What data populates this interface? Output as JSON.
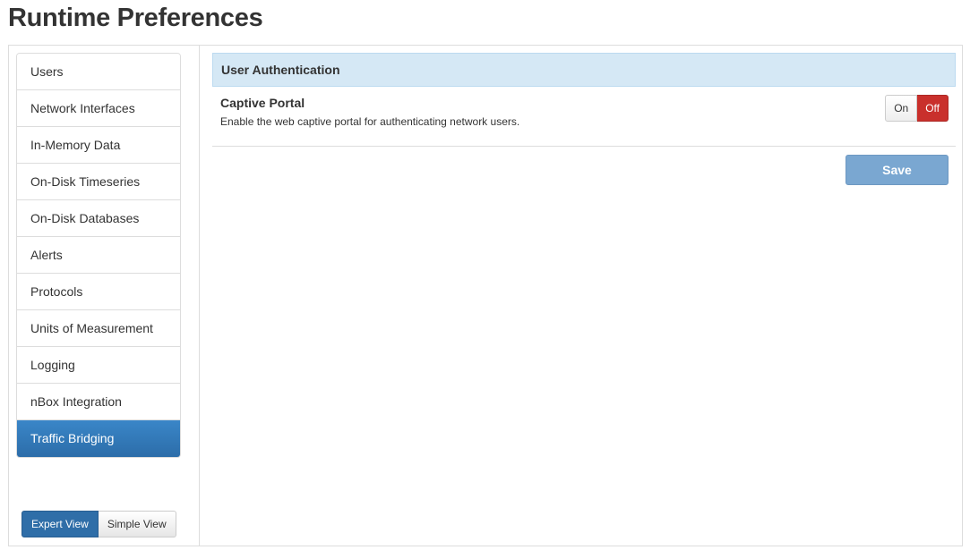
{
  "page": {
    "title": "Runtime Preferences"
  },
  "sidebar": {
    "items": [
      {
        "label": "Users",
        "active": false
      },
      {
        "label": "Network Interfaces",
        "active": false
      },
      {
        "label": "In-Memory Data",
        "active": false
      },
      {
        "label": "On-Disk Timeseries",
        "active": false
      },
      {
        "label": "On-Disk Databases",
        "active": false
      },
      {
        "label": "Alerts",
        "active": false
      },
      {
        "label": "Protocols",
        "active": false
      },
      {
        "label": "Units of Measurement",
        "active": false
      },
      {
        "label": "Logging",
        "active": false
      },
      {
        "label": "nBox Integration",
        "active": false
      },
      {
        "label": "Traffic Bridging",
        "active": true
      }
    ],
    "view_toggle": {
      "expert_label": "Expert View",
      "simple_label": "Simple View",
      "selected": "Expert View"
    }
  },
  "main": {
    "section_heading": "User Authentication",
    "settings": [
      {
        "title": "Captive Portal",
        "description": "Enable the web captive portal for authenticating network users.",
        "on_label": "On",
        "off_label": "Off",
        "value": "Off"
      }
    ],
    "save_label": "Save"
  },
  "colors": {
    "active_nav": "#2c6da9",
    "heading_bg": "#d5e8f5",
    "off_active": "#c9302c",
    "save_button": "#7aa7d1"
  }
}
